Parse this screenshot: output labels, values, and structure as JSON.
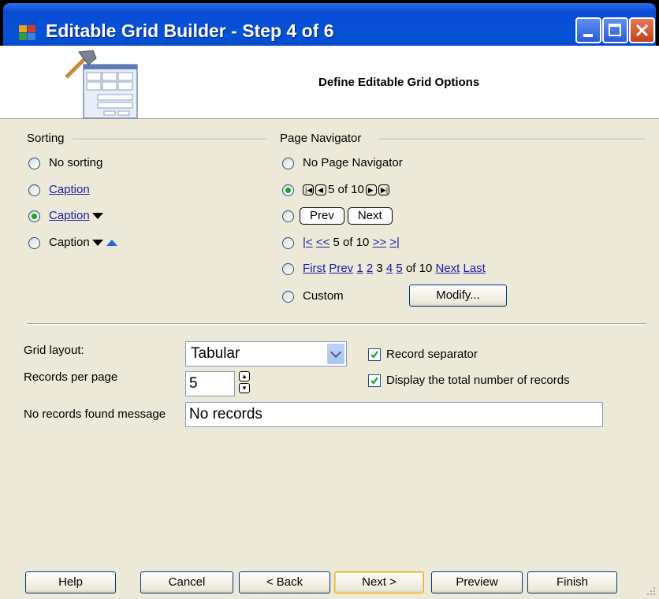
{
  "window": {
    "title": "Editable Grid Builder - Step 4 of 6"
  },
  "header": {
    "title": "Define Editable Grid Options"
  },
  "sorting": {
    "legend": "Sorting",
    "options": [
      {
        "label": "No sorting",
        "link": false,
        "selected": false
      },
      {
        "label": "Caption",
        "link": true,
        "selected": false
      },
      {
        "label": "Caption",
        "link": true,
        "selected": true
      },
      {
        "label": "Caption",
        "link": false,
        "selected": false
      }
    ]
  },
  "navigator": {
    "legend": "Page Navigator",
    "options": {
      "none": "No Page Navigator",
      "images_text": "5 of 10",
      "prev_label": "Prev",
      "next_label": "Next",
      "arrows": {
        "first": "|<",
        "prev": "<<",
        "text": "5 of 10",
        "next": ">>",
        "last": ">|"
      },
      "links": {
        "first": "First",
        "prev": "Prev",
        "p1": "1",
        "p2": "2",
        "p3": "3",
        "p4": "4",
        "p5": "5",
        "of10": "of 10",
        "next": "Next",
        "last": "Last"
      },
      "custom": "Custom"
    },
    "selected_index": 1,
    "modify_label": "Modify..."
  },
  "options": {
    "grid_layout_label": "Grid layout:",
    "grid_layout_value": "Tabular",
    "records_per_page_label": "Records per page",
    "records_per_page_value": "5",
    "no_records_label": "No records found message",
    "no_records_value": "No records",
    "record_separator_label": "Record separator",
    "record_separator_checked": true,
    "display_total_label": "Display the total number of records",
    "display_total_checked": true
  },
  "buttons": {
    "help": "Help",
    "cancel": "Cancel",
    "back": "< Back",
    "next": "Next >",
    "preview": "Preview",
    "finish": "Finish"
  },
  "colors": {
    "titlebar": "#0453d6",
    "dialog": "#ece9d8",
    "link": "#1a1aa6",
    "radio_dot": "#21a121",
    "check": "#21a121"
  }
}
